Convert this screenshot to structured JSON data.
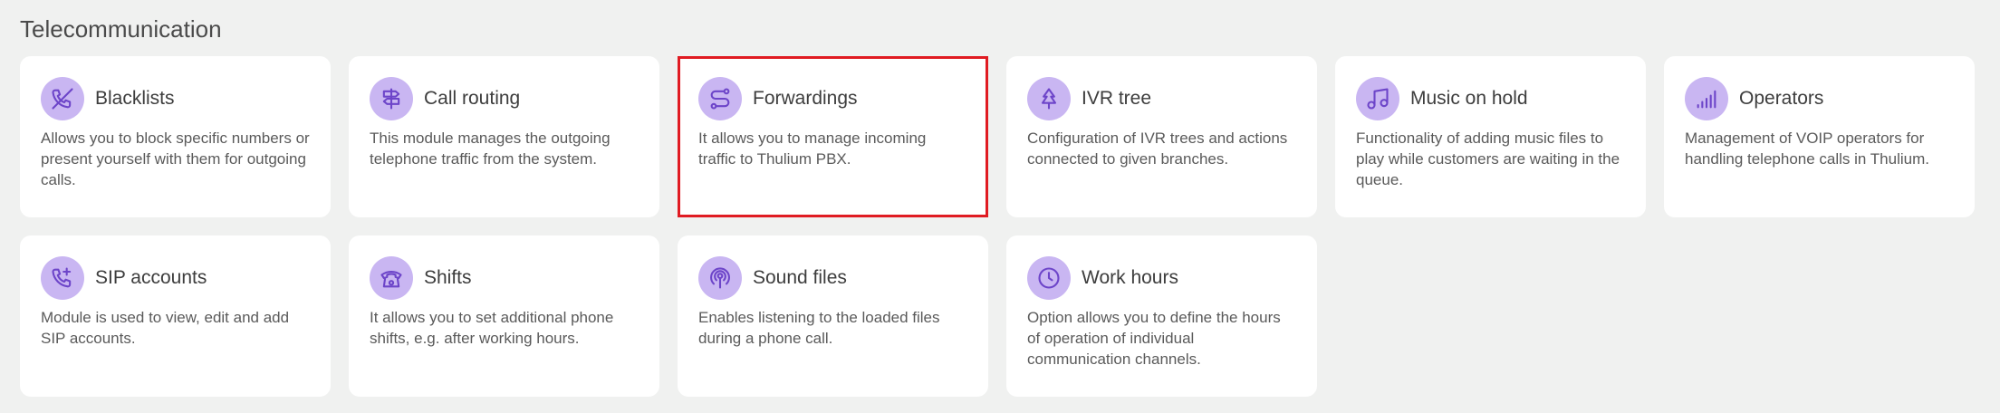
{
  "section": {
    "title": "Telecommunication"
  },
  "cards": [
    {
      "title": "Blacklists",
      "description": "Allows you to block specific numbers or present yourself with them for outgoing calls.",
      "icon": "phone-blocked-icon"
    },
    {
      "title": "Call routing",
      "description": "This module manages the outgoing telephone traffic from the system.",
      "icon": "signpost-icon"
    },
    {
      "title": "Forwardings",
      "description": "It allows you to manage incoming traffic to Thulium PBX.",
      "icon": "route-icon"
    },
    {
      "title": "IVR tree",
      "description": "Configuration of IVR trees and actions connected to given branches.",
      "icon": "tree-icon"
    },
    {
      "title": "Music on hold",
      "description": "Functionality of adding music files to play while customers are waiting in the queue.",
      "icon": "music-note-icon"
    },
    {
      "title": "Operators",
      "description": "Management of VOIP operators for handling telephone calls in Thulium.",
      "icon": "signal-bars-icon"
    },
    {
      "title": "SIP accounts",
      "description": "Module is used to view, edit and add SIP accounts.",
      "icon": "phone-plus-icon"
    },
    {
      "title": "Shifts",
      "description": "It allows you to set additional phone shifts, e.g. after working hours.",
      "icon": "desk-phone-icon"
    },
    {
      "title": "Sound files",
      "description": "Enables listening to the loaded files during a phone call.",
      "icon": "podcast-icon"
    },
    {
      "title": "Work hours",
      "description": "Option allows you to define the hours of operation of individual communication channels.",
      "icon": "clock-icon"
    }
  ],
  "colors": {
    "background": "#f0f1f0",
    "card": "#ffffff",
    "icon_bg": "#c9b6f2",
    "icon_stroke": "#6d45c9",
    "highlight": "#e01b22"
  }
}
